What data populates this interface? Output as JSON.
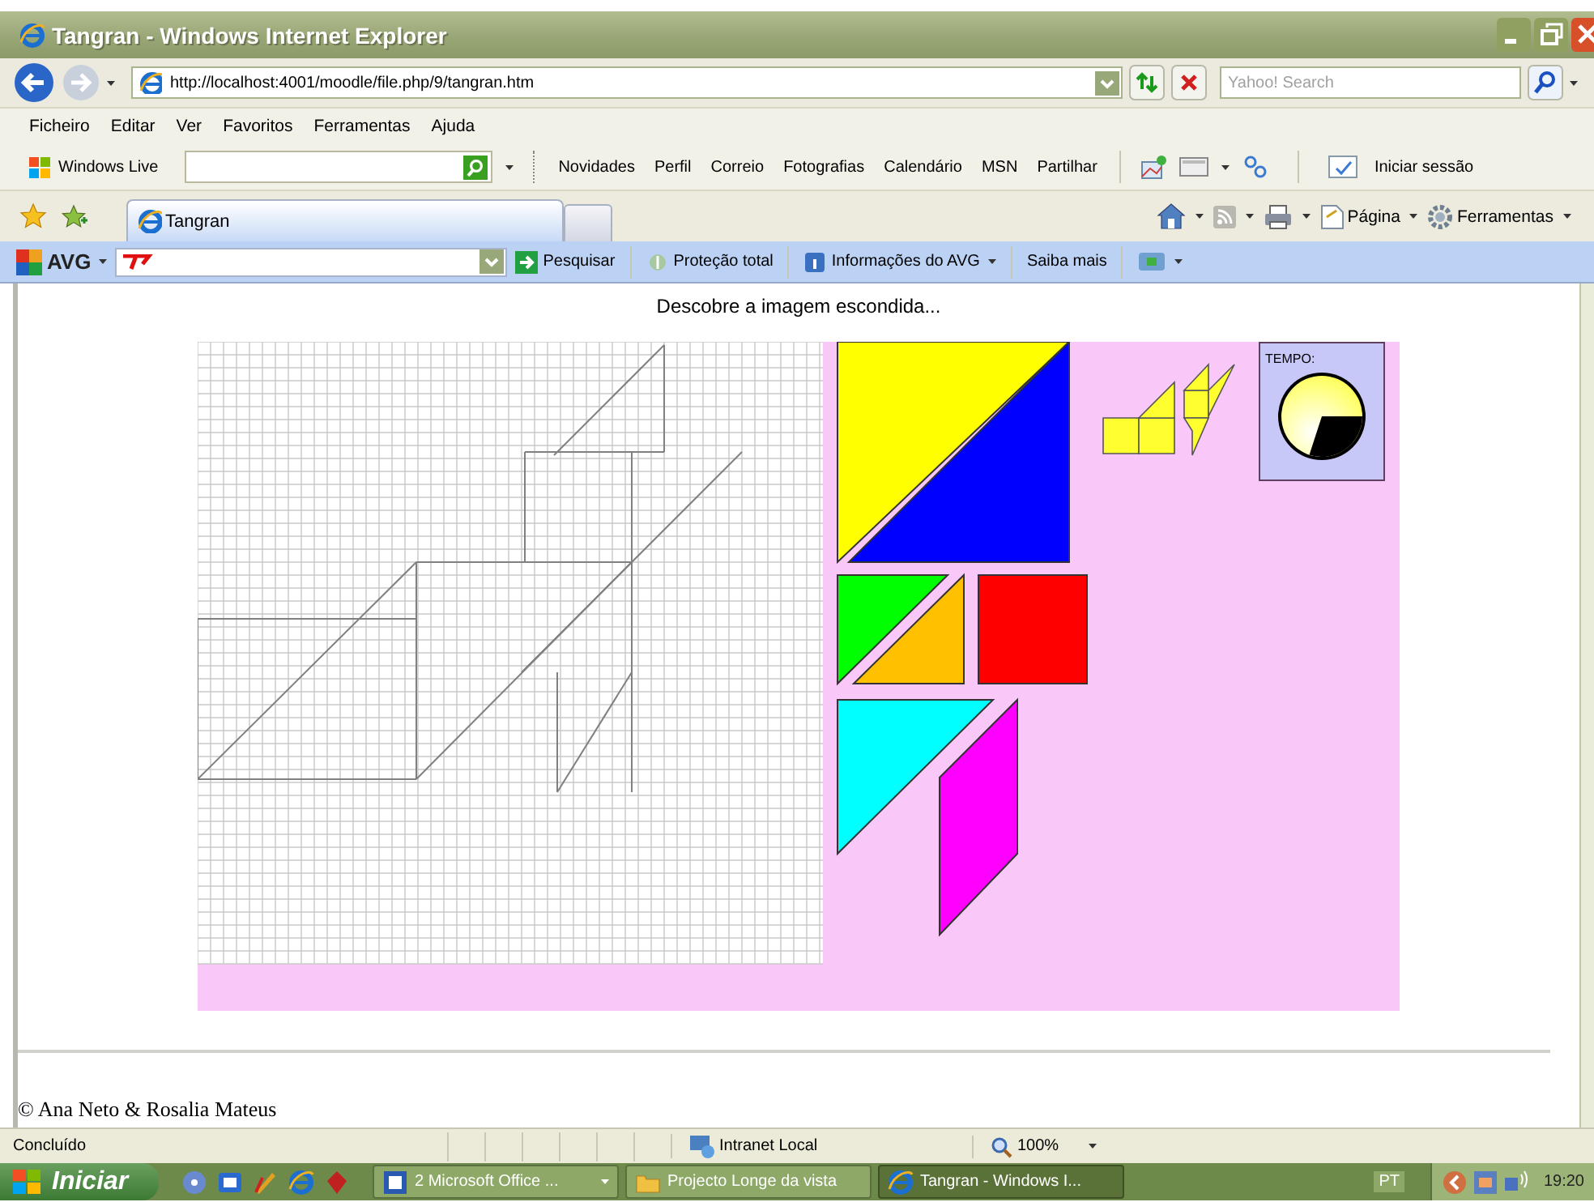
{
  "window": {
    "title": "Tangran - Windows Internet Explorer"
  },
  "address_bar": {
    "url": "http://localhost:4001/moodle/file.php/9/tangran.htm"
  },
  "search": {
    "placeholder": "Yahoo! Search"
  },
  "menu": [
    "Ficheiro",
    "Editar",
    "Ver",
    "Favoritos",
    "Ferramentas",
    "Ajuda"
  ],
  "links_toolbar": {
    "brand": "Windows Live",
    "items": [
      "Novidades",
      "Perfil",
      "Correio",
      "Fotografias",
      "Calendário",
      "MSN",
      "Partilhar"
    ],
    "sign_in": "Iniciar sessão"
  },
  "tabs": [
    {
      "label": "Tangran",
      "selected": true
    }
  ],
  "command_bar": [
    "Página",
    "Ferramentas"
  ],
  "avg_toolbar": {
    "brand": "AVG",
    "items": [
      "Pesquisar",
      "Proteção total",
      "Informações do AVG",
      "Saiba mais"
    ]
  },
  "page": {
    "heading": "Descobre a imagem escondida...",
    "pieces": [
      {
        "color": "#ffff00"
      },
      {
        "color": "#0000ff"
      },
      {
        "color": "#00ff00"
      },
      {
        "color": "#ffc000"
      },
      {
        "color": "#ff0000"
      },
      {
        "color": "#00ffff"
      },
      {
        "color": "#ff00ff"
      }
    ],
    "timer": {
      "label": "TEMPO:",
      "level": 0.7
    },
    "footer": "© Ana Neto & Rosalia Mateus"
  },
  "status_bar": {
    "text": "Concluído",
    "zone": "Intranet Local",
    "zoom": "100%"
  },
  "taskbar": {
    "start": "Iniciar",
    "tasks": [
      {
        "label": "2 Microsoft Office ...",
        "selected": false
      },
      {
        "label": "Projecto Longe da vista",
        "selected": false
      },
      {
        "label": "Tangran - Windows I...",
        "selected": true
      }
    ],
    "language": "PT",
    "clock": "19:20"
  }
}
